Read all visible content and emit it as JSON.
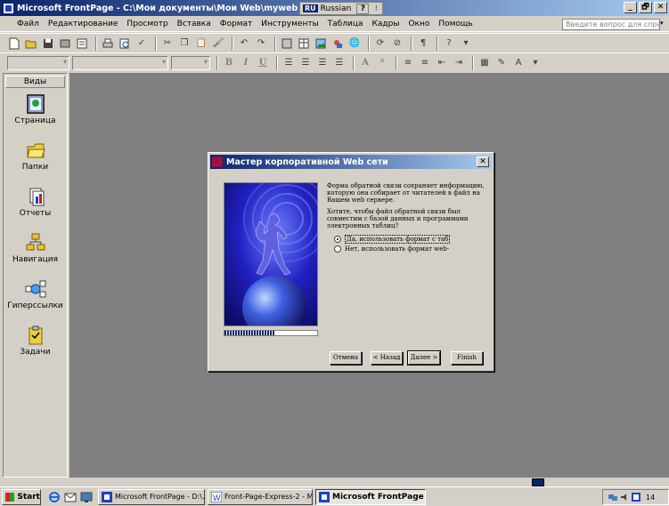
{
  "window": {
    "title": "Microsoft FrontPage - C:\\Мои документы\\Мои Web\\myweb",
    "controls": [
      "_",
      "🗗",
      "✕"
    ]
  },
  "language_bar": {
    "code": "RU",
    "name": "Russian",
    "help": "?",
    "options": "⁝"
  },
  "menu": {
    "items": [
      "Файл",
      "Редактирование",
      "Просмотр",
      "Вставка",
      "Формат",
      "Инструменты",
      "Таблица",
      "Кадры",
      "Окно",
      "Помощь"
    ],
    "help_placeholder": "Введите вопрос для спра"
  },
  "toolbar_format": {
    "bold": "B",
    "italic": "I",
    "underline": "U"
  },
  "views_bar": {
    "header": "Виды",
    "items": [
      {
        "label": "Страница",
        "icon": "page-icon"
      },
      {
        "label": "Папки",
        "icon": "folder-icon"
      },
      {
        "label": "Отчеты",
        "icon": "reports-icon"
      },
      {
        "label": "Навигация",
        "icon": "navigation-icon"
      },
      {
        "label": "Гиперссылки",
        "icon": "hyperlinks-icon"
      },
      {
        "label": "Задачи",
        "icon": "tasks-icon"
      }
    ]
  },
  "dialog": {
    "title": "Мастер корпоративной Web сети",
    "close": "✕",
    "paragraph1": "Форма обратной связи сохраняет информацию, которую она собирает от читателей в файл на Вашем web сервере.",
    "paragraph2": "Хотите, чтобы файл обратной связи был совместим с базой данных и программами электронных таблиц?",
    "radio_options": [
      {
        "label": "Да, использовать формат с таб",
        "selected": true
      },
      {
        "label": "Нет, использовать формат web-",
        "selected": false
      }
    ],
    "progress": 0.55,
    "buttons": {
      "cancel": "Отмена",
      "back": "< Назад",
      "next": "Далее >",
      "finish": "Finish"
    }
  },
  "taskbar": {
    "start": "Start",
    "tasks": [
      {
        "label": "Microsoft FrontPage - D:\\...",
        "active": false
      },
      {
        "label": "Front-Page-Express-2 - Mic...",
        "active": false
      },
      {
        "label": "Microsoft FrontPage -...",
        "active": true
      }
    ],
    "clock": "14"
  },
  "colors": {
    "titlebar_start": "#0a246a",
    "titlebar_end": "#a6caf0",
    "face": "#d4d0c8",
    "workspace": "#808080"
  }
}
